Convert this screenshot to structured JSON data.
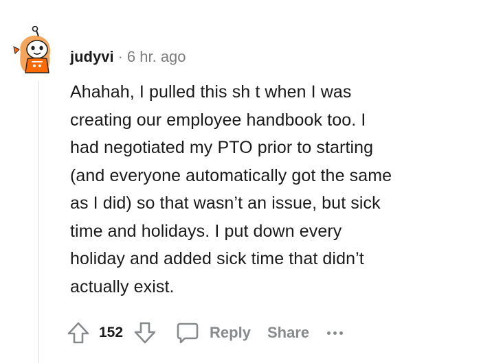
{
  "comment": {
    "author": "judyvi",
    "separator": "·",
    "time_ago": "6 hr. ago",
    "body": "Ahahah, I pulled this sh  t when I was\ncreating our employee handbook too. I\nhad negotiated my PTO prior to starting\n(and everyone automatically got the same\nas I did) so that wasn’t an issue, but sick\ntime and holidays. I put down every\nholiday and added sick time that didn’t\nactually exist."
  },
  "actions": {
    "upvote_icon": "upvote-arrow-icon",
    "vote_count": "152",
    "downvote_icon": "downvote-arrow-icon",
    "reply_icon": "speech-bubble-icon",
    "reply_label": "Reply",
    "share_label": "Share",
    "more_icon": "ellipsis-icon"
  },
  "colors": {
    "text": "#1a1a1b",
    "muted": "#878a8c",
    "avatar_accent": "#ff6a00",
    "thread_line": "#edeff1"
  }
}
